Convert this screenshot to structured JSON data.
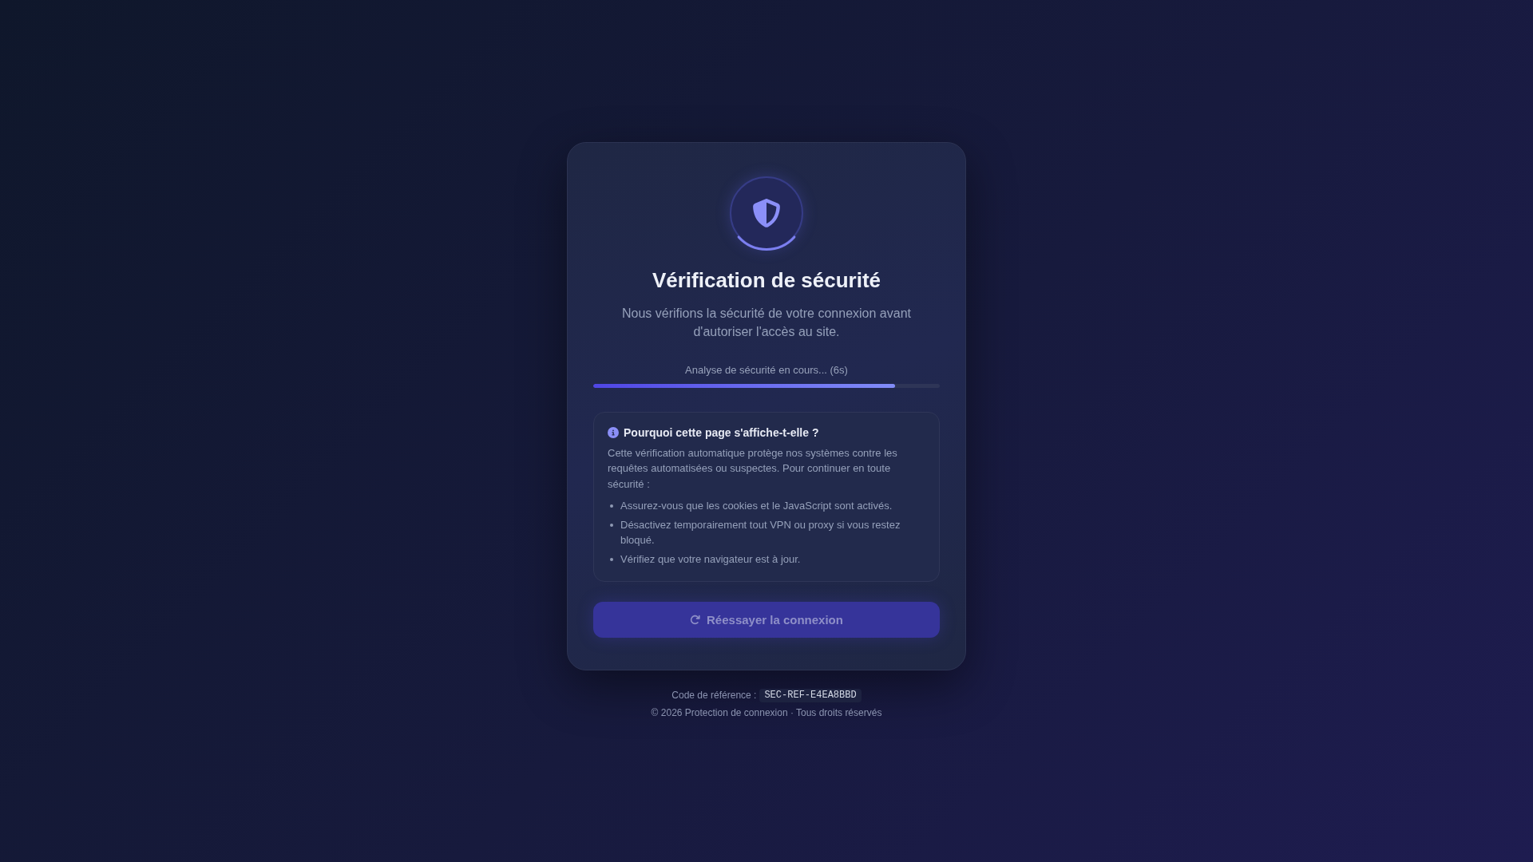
{
  "title": "Vérification de sécurité",
  "subtitle": "Nous vérifions la sécurité de votre connexion avant d'autoriser l'accès au site.",
  "progress": {
    "label": "Analyse de sécurité en cours... (6s)",
    "level": 0.87
  },
  "info": {
    "heading": "Pourquoi cette page s'affiche-t-elle ?",
    "text": "Cette vérification automatique protège nos systèmes contre les requêtes automatisées ou suspectes. Pour continuer en toute sécurité :",
    "items": [
      "Assurez-vous que les cookies et le JavaScript sont activés.",
      "Désactivez temporairement tout VPN ou proxy si vous restez bloqué.",
      "Vérifiez que votre navigateur est à jour."
    ]
  },
  "retry_button": {
    "label": "Réessayer la connexion",
    "disabled": true
  },
  "footer": {
    "reference_label": "Code de référence :",
    "reference_code": "SEC-REF-E4EA8BBD",
    "copyright": "© 2026 Protection de connexion · Tous droits réservés"
  }
}
